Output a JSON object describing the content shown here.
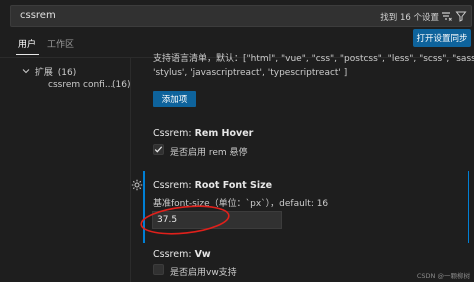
{
  "search": {
    "value": "cssrem",
    "match_count": "找到 16 个设置"
  },
  "tabs": {
    "user": "用户",
    "workspace": "工作区"
  },
  "toolbar": {
    "open_json_label": "打开设置同步"
  },
  "tree": {
    "group_label": "扩展",
    "group_count": "(16)",
    "item_label": "cssrem confi...",
    "item_count": "(16)"
  },
  "languages_setting": {
    "desc_line1": "支持语言清单，默认：[\"html\", \"vue\", \"css\", \"postcss\", \"less\", \"scss\", \"sass\",",
    "desc_line2": "'stylus', 'javascriptreact', 'typescriptreact' ]",
    "add_button": "添加项"
  },
  "rem_hover": {
    "prefix": "Cssrem: ",
    "title": "Rem Hover",
    "checkbox_label": "是否启用 rem 悬停",
    "checked": true
  },
  "root_font_size": {
    "prefix": "Cssrem: ",
    "title": "Root Font Size",
    "desc": "基准font-size（单位：`px`），default: 16",
    "value": "37.5"
  },
  "vw": {
    "prefix": "Cssrem: ",
    "title": "Vw",
    "checkbox_label": "是否启用vw支持",
    "checked": false
  },
  "watermark": "CSDN @一颗柳树",
  "colors": {
    "accent": "#0e639c",
    "focus": "#007fd4",
    "annotation": "#e0201b"
  }
}
